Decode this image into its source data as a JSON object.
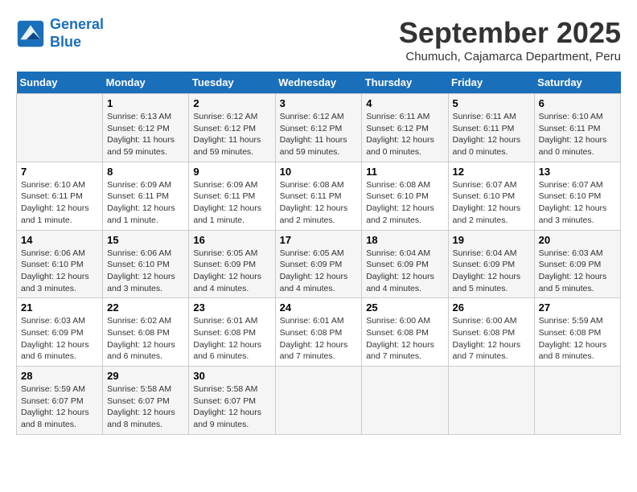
{
  "header": {
    "logo_line1": "General",
    "logo_line2": "Blue",
    "month": "September 2025",
    "location": "Chumuch, Cajamarca Department, Peru"
  },
  "weekdays": [
    "Sunday",
    "Monday",
    "Tuesday",
    "Wednesday",
    "Thursday",
    "Friday",
    "Saturday"
  ],
  "weeks": [
    [
      {
        "day": "",
        "info": ""
      },
      {
        "day": "1",
        "info": "Sunrise: 6:13 AM\nSunset: 6:12 PM\nDaylight: 11 hours and 59 minutes."
      },
      {
        "day": "2",
        "info": "Sunrise: 6:12 AM\nSunset: 6:12 PM\nDaylight: 11 hours and 59 minutes."
      },
      {
        "day": "3",
        "info": "Sunrise: 6:12 AM\nSunset: 6:12 PM\nDaylight: 11 hours and 59 minutes."
      },
      {
        "day": "4",
        "info": "Sunrise: 6:11 AM\nSunset: 6:12 PM\nDaylight: 12 hours and 0 minutes."
      },
      {
        "day": "5",
        "info": "Sunrise: 6:11 AM\nSunset: 6:11 PM\nDaylight: 12 hours and 0 minutes."
      },
      {
        "day": "6",
        "info": "Sunrise: 6:10 AM\nSunset: 6:11 PM\nDaylight: 12 hours and 0 minutes."
      }
    ],
    [
      {
        "day": "7",
        "info": "Sunrise: 6:10 AM\nSunset: 6:11 PM\nDaylight: 12 hours and 1 minute."
      },
      {
        "day": "8",
        "info": "Sunrise: 6:09 AM\nSunset: 6:11 PM\nDaylight: 12 hours and 1 minute."
      },
      {
        "day": "9",
        "info": "Sunrise: 6:09 AM\nSunset: 6:11 PM\nDaylight: 12 hours and 1 minute."
      },
      {
        "day": "10",
        "info": "Sunrise: 6:08 AM\nSunset: 6:11 PM\nDaylight: 12 hours and 2 minutes."
      },
      {
        "day": "11",
        "info": "Sunrise: 6:08 AM\nSunset: 6:10 PM\nDaylight: 12 hours and 2 minutes."
      },
      {
        "day": "12",
        "info": "Sunrise: 6:07 AM\nSunset: 6:10 PM\nDaylight: 12 hours and 2 minutes."
      },
      {
        "day": "13",
        "info": "Sunrise: 6:07 AM\nSunset: 6:10 PM\nDaylight: 12 hours and 3 minutes."
      }
    ],
    [
      {
        "day": "14",
        "info": "Sunrise: 6:06 AM\nSunset: 6:10 PM\nDaylight: 12 hours and 3 minutes."
      },
      {
        "day": "15",
        "info": "Sunrise: 6:06 AM\nSunset: 6:10 PM\nDaylight: 12 hours and 3 minutes."
      },
      {
        "day": "16",
        "info": "Sunrise: 6:05 AM\nSunset: 6:09 PM\nDaylight: 12 hours and 4 minutes."
      },
      {
        "day": "17",
        "info": "Sunrise: 6:05 AM\nSunset: 6:09 PM\nDaylight: 12 hours and 4 minutes."
      },
      {
        "day": "18",
        "info": "Sunrise: 6:04 AM\nSunset: 6:09 PM\nDaylight: 12 hours and 4 minutes."
      },
      {
        "day": "19",
        "info": "Sunrise: 6:04 AM\nSunset: 6:09 PM\nDaylight: 12 hours and 5 minutes."
      },
      {
        "day": "20",
        "info": "Sunrise: 6:03 AM\nSunset: 6:09 PM\nDaylight: 12 hours and 5 minutes."
      }
    ],
    [
      {
        "day": "21",
        "info": "Sunrise: 6:03 AM\nSunset: 6:09 PM\nDaylight: 12 hours and 6 minutes."
      },
      {
        "day": "22",
        "info": "Sunrise: 6:02 AM\nSunset: 6:08 PM\nDaylight: 12 hours and 6 minutes."
      },
      {
        "day": "23",
        "info": "Sunrise: 6:01 AM\nSunset: 6:08 PM\nDaylight: 12 hours and 6 minutes."
      },
      {
        "day": "24",
        "info": "Sunrise: 6:01 AM\nSunset: 6:08 PM\nDaylight: 12 hours and 7 minutes."
      },
      {
        "day": "25",
        "info": "Sunrise: 6:00 AM\nSunset: 6:08 PM\nDaylight: 12 hours and 7 minutes."
      },
      {
        "day": "26",
        "info": "Sunrise: 6:00 AM\nSunset: 6:08 PM\nDaylight: 12 hours and 7 minutes."
      },
      {
        "day": "27",
        "info": "Sunrise: 5:59 AM\nSunset: 6:08 PM\nDaylight: 12 hours and 8 minutes."
      }
    ],
    [
      {
        "day": "28",
        "info": "Sunrise: 5:59 AM\nSunset: 6:07 PM\nDaylight: 12 hours and 8 minutes."
      },
      {
        "day": "29",
        "info": "Sunrise: 5:58 AM\nSunset: 6:07 PM\nDaylight: 12 hours and 8 minutes."
      },
      {
        "day": "30",
        "info": "Sunrise: 5:58 AM\nSunset: 6:07 PM\nDaylight: 12 hours and 9 minutes."
      },
      {
        "day": "",
        "info": ""
      },
      {
        "day": "",
        "info": ""
      },
      {
        "day": "",
        "info": ""
      },
      {
        "day": "",
        "info": ""
      }
    ]
  ]
}
